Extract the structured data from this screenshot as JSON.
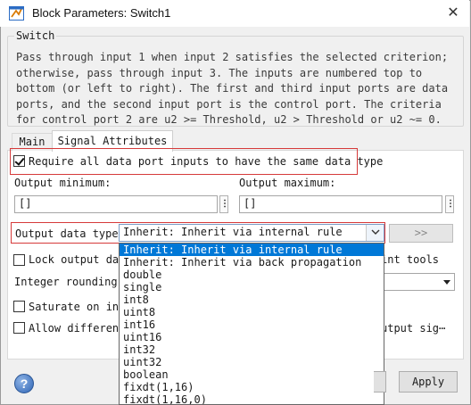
{
  "window": {
    "title": "Block Parameters: Switch1",
    "close_glyph": "✕",
    "icon": "simulink-block-icon"
  },
  "group": {
    "label": "Switch",
    "description": "Pass through input 1 when input 2 satisfies the selected criterion; otherwise, pass through input 3. The inputs are numbered top to bottom (or left to right). The first and third input ports are data ports, and the second input port is the control port. The criteria for control port 2 are u2 >= Threshold, u2 > Threshold or u2 ~= 0."
  },
  "tabs": [
    {
      "label": "Main",
      "active": false
    },
    {
      "label": "Signal Attributes",
      "active": true
    }
  ],
  "signal_attributes": {
    "require_same_type": {
      "label": "Require all data port inputs to have the same data type",
      "checked": true
    },
    "output_minimum": {
      "label": "Output minimum:",
      "value": "[]"
    },
    "output_maximum": {
      "label": "Output maximum:",
      "value": "[]"
    },
    "more_glyph": "⋮",
    "output_data_type": {
      "label": "Output data type:",
      "value": "Inherit: Inherit via internal rule",
      "assistant_label": ">>"
    },
    "lock_output": {
      "label": "Lock output data type setting against changes by the fixed-point tools",
      "visible_label": "Lock output data",
      "visible_tail": "int tools",
      "checked": false
    },
    "integer_rounding": {
      "label": "Integer rounding m"
    },
    "saturate": {
      "label": "Saturate on inte",
      "checked": false
    },
    "allow_different": {
      "label": "Allow different",
      "visible_tail": "utput sig⋯",
      "checked": false
    }
  },
  "dropdown": {
    "options": [
      "Inherit: Inherit via internal rule",
      "Inherit: Inherit via back propagation",
      "double",
      "single",
      "int8",
      "uint8",
      "int16",
      "uint16",
      "int32",
      "uint32",
      "boolean",
      "fixdt(1,16)",
      "fixdt(1,16,0)"
    ],
    "selected_index": 0
  },
  "footer": {
    "help_glyph": "?",
    "apply_label": "Apply"
  },
  "colors": {
    "highlight": "#d63a3a",
    "selection": "#0078d7"
  }
}
